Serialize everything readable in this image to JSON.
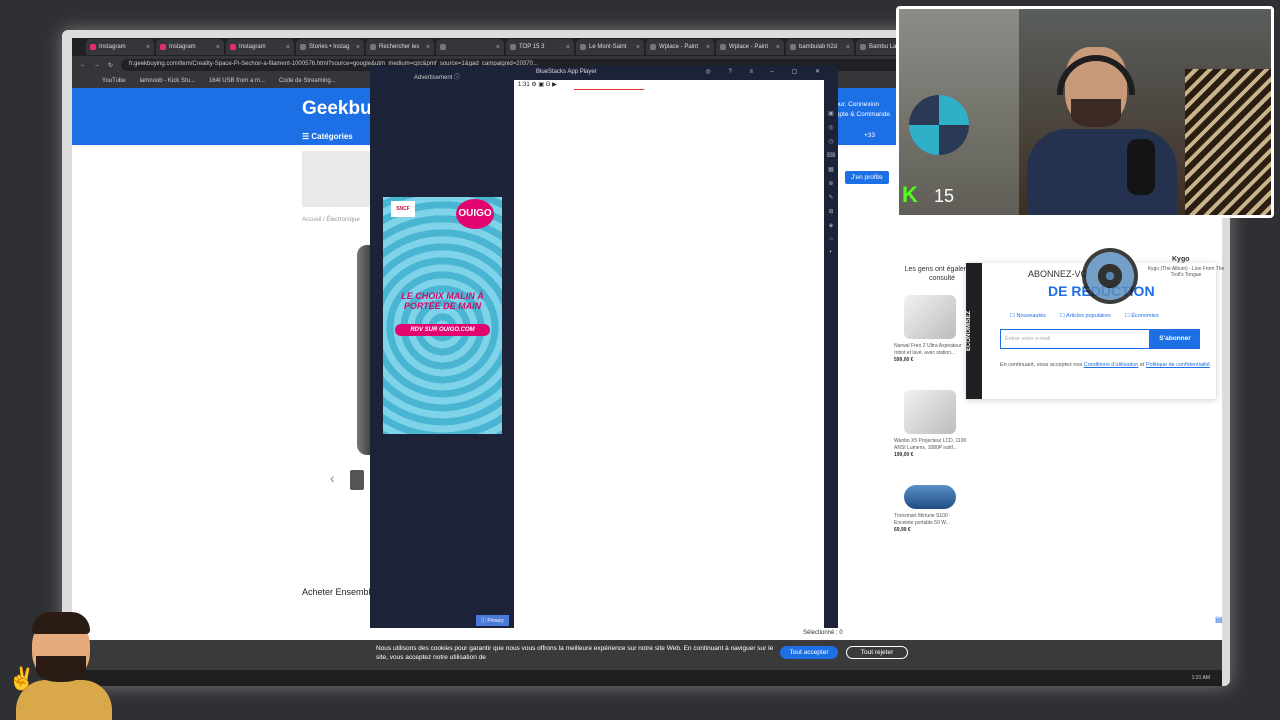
{
  "browser": {
    "tabs": [
      "Instagram",
      "Instagram",
      "Instagram",
      "Stories • Instag",
      "Rechercher les",
      "",
      "TOP 15 3",
      "Le Mont-Saint",
      "Wplace - Paint",
      "Wplace - Paint",
      "bambulab h2d",
      "Bambu Lab H"
    ],
    "url": "fr.geekbuying.com/item/Creality-Space-Pi-Sechoir-a-filament-1000576.html?source=google&utm_medium=cpc&pmf_source=1&gad_campaignid=20370...",
    "bookmarks": [
      "YouTube",
      "lamnoob - Kick Stu...",
      "164t USB from a m...",
      "Code de Streaming..."
    ]
  },
  "site": {
    "logo": "Geekbuying",
    "categories": "☰ Catégories",
    "header_links": [
      "jour. Connexion",
      "mpte & Commande"
    ],
    "phone": "+33",
    "cta": "J'en profite",
    "breadcrumb": "Accueil / Électronique",
    "buy_set": "Acheter Ensemble",
    "seen_title": "Les gens ont également consulté",
    "products": [
      {
        "name": "Narwal Freo Z Ultra Aspirateur robot et lavé, avec station...",
        "price": "599,00 €"
      },
      {
        "name": "Wanbo X5 Projecteur LCD, 1100 ANSI Lumens, 1080P natif...",
        "price": "199,00 €"
      },
      {
        "name": "Tronsmart Mirtune S100 Enceinte portable 50 W...",
        "price": "69,99 €"
      }
    ]
  },
  "newsletter": {
    "side_label": "ÉCONOMISEZ",
    "title": "ABONNEZ-VO",
    "subtitle": "DE RÉDUCTION",
    "options": [
      "Nouveautés",
      "Articles populaires",
      "Économies"
    ],
    "email_placeholder": "Entrer votre e-mail",
    "subscribe": "S'abonner",
    "legal_prefix": "En continuant, vous acceptez nos",
    "terms": "Conditions d'utilisation",
    "legal_and": "et",
    "privacy": "Politique de confidentialité"
  },
  "music": {
    "artist": "Kygo",
    "album": "Kygo (The Album) - Live From The Troll's Tongue"
  },
  "bluestacks": {
    "ad_label": "Advertisement ⓘ",
    "title": "BlueStacks App Player",
    "status_time": "1:31",
    "privacy": "ⓘ Privacy",
    "ad": {
      "sncf": "SNCF",
      "brand": "OUIGO",
      "slogan": "LE CHOIX MALIN À PORTÉE DE MAIN",
      "cta": "RDV SUR OUIGO.COM"
    }
  },
  "selected": "Sélectionné : 0",
  "cookie": {
    "message": "Nous utilisons des cookies pour garantir que nous vous offrons la meilleure expérience sur notre site Web. En continuant à naviguer sur le site, vous acceptez notre utilisation de",
    "accept": "Tout accepter",
    "reject": "Tout rejeter"
  },
  "taskbar": {
    "time": "1:31 AM"
  },
  "stream": {
    "kick_logo": "K",
    "viewer_count": "15"
  }
}
